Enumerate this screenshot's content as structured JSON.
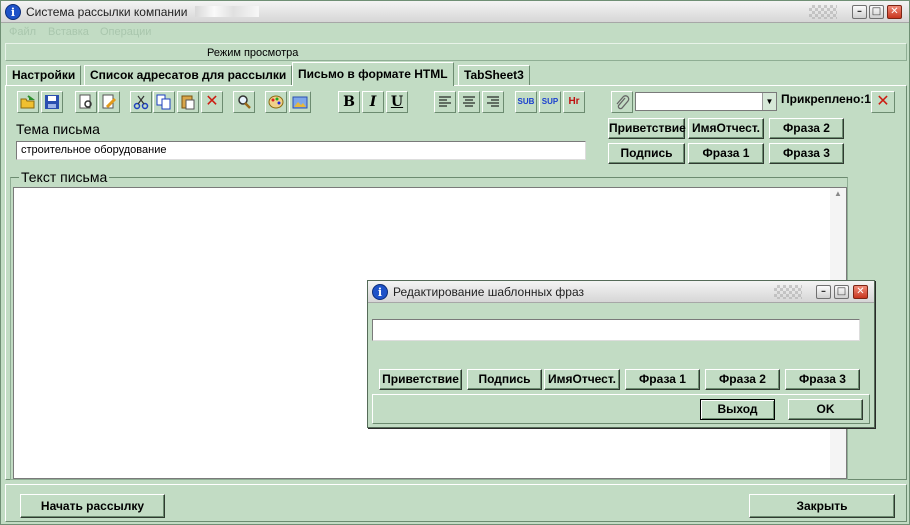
{
  "window": {
    "title": "Система рассылки компании"
  },
  "menu": {
    "items": [
      "Файл",
      "Вставка",
      "Операции"
    ]
  },
  "mode": {
    "label": "Режим просмотра"
  },
  "tabs": [
    {
      "label": "Настройки",
      "active": false
    },
    {
      "label": "Список адресатов для рассылки",
      "active": false
    },
    {
      "label": "Письмо в формате HTML",
      "active": true
    },
    {
      "label": "TabSheet3",
      "active": false
    }
  ],
  "toolbar": {
    "icons": [
      "open-folder-icon",
      "save-icon",
      "preview-icon",
      "edit-icon",
      "cut-icon",
      "copy-icon",
      "paste-icon",
      "delete-icon",
      "find-icon",
      "color-palette-icon",
      "image-icon"
    ],
    "bold": "B",
    "italic": "I",
    "underline": "U",
    "sub": "SUB",
    "sup": "SUP",
    "hr": "Hr",
    "attach_label": "Прикреплено:1",
    "attach_value": ""
  },
  "subject": {
    "label": "Тема письма",
    "value": "строительное оборудование"
  },
  "phrases": {
    "greeting": "Приветствие",
    "name_patronymic": "ИмяОтчест.",
    "phrase2": "Фраза 2",
    "signature": "Подпись",
    "phrase1": "Фраза 1",
    "phrase3": "Фраза 3"
  },
  "body": {
    "label": "Текст письма",
    "value": ""
  },
  "footer": {
    "start_label": "Начать рассылку",
    "close_label": "Закрыть"
  },
  "dialog": {
    "title": "Редактирование шаблонных фраз",
    "input_value": "",
    "buttons": {
      "greeting": "Приветствие",
      "signature": "Подпись",
      "name_patronymic": "ИмяОтчест.",
      "phrase1": "Фраза 1",
      "phrase2": "Фраза 2",
      "phrase3": "Фраза 3"
    },
    "exit_label": "Выход",
    "ok_label": "OK"
  },
  "colors": {
    "background": "#c2dcc4",
    "title_icon": "#1e52c8",
    "delete_red": "#cc1c12"
  }
}
